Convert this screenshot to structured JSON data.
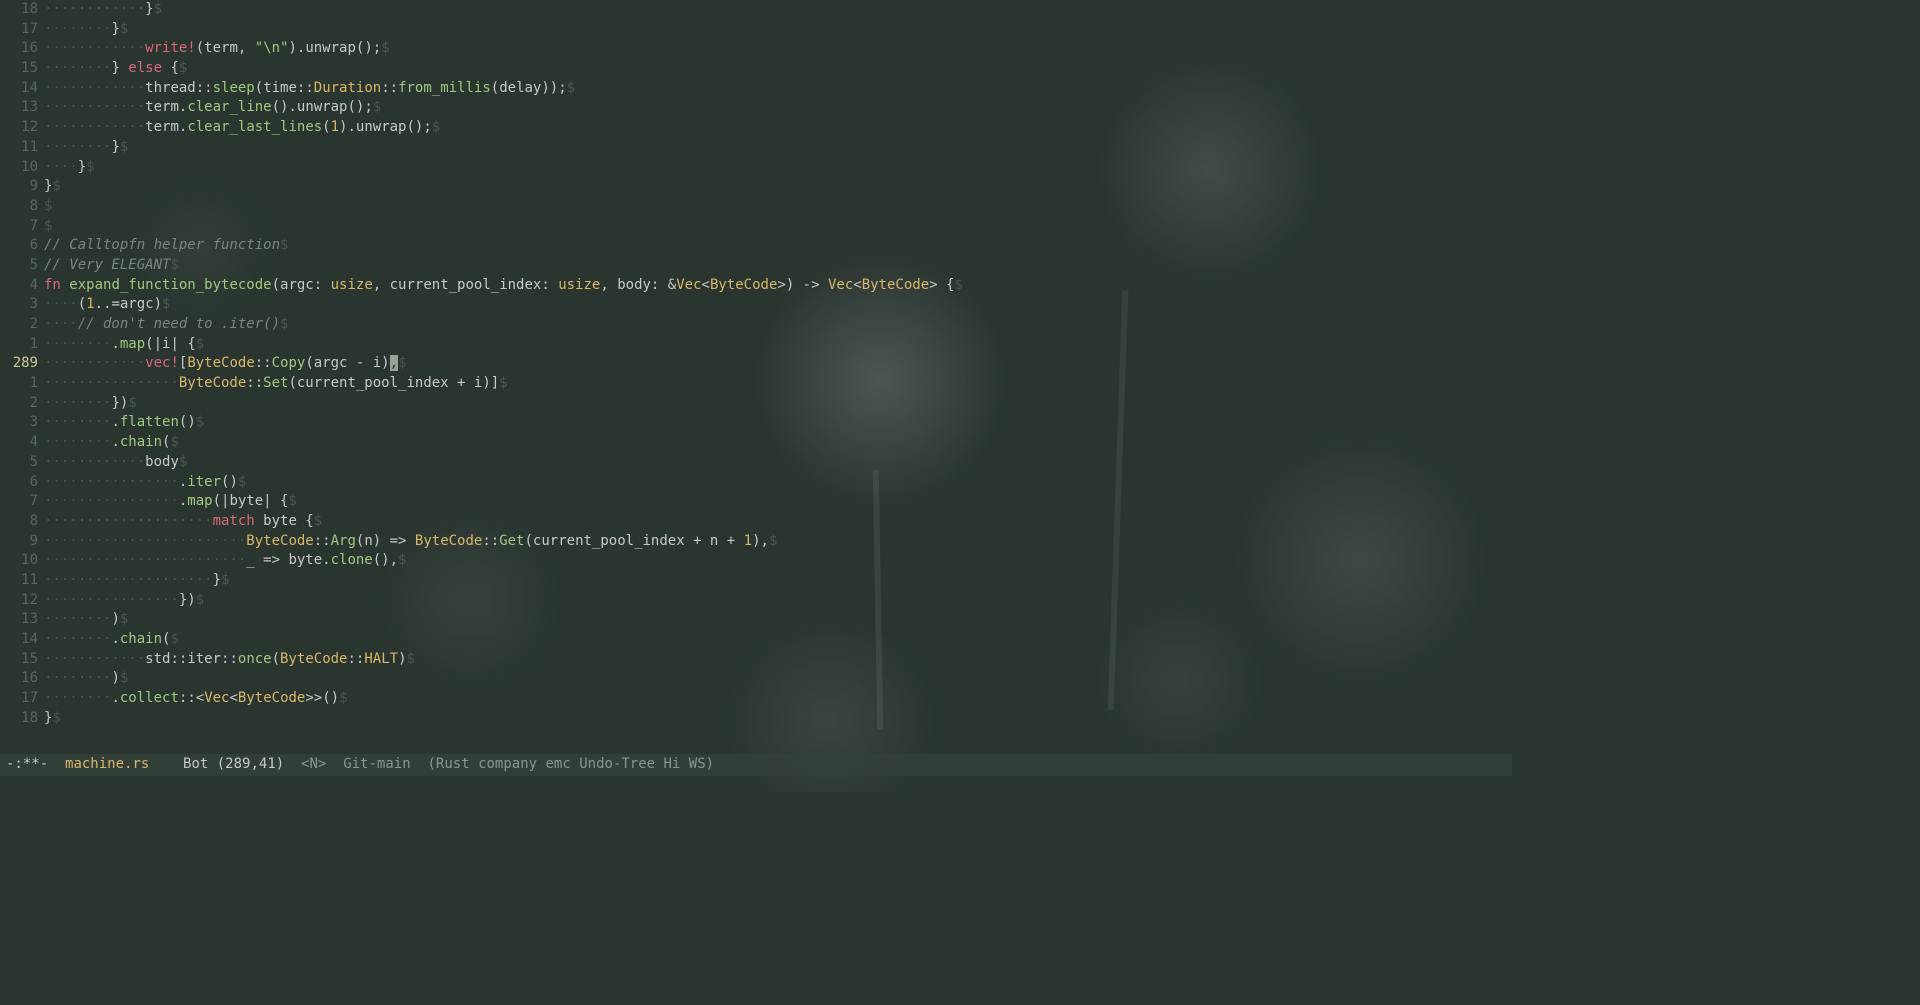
{
  "modeline": {
    "modified": "-:**-",
    "filename": "machine.rs",
    "position": "Bot (289,41)",
    "mode": "<N>",
    "vcs": "Git-main",
    "minor": "(Rust company emc Undo-Tree Hi WS)"
  },
  "cursor": {
    "line_abs": 289,
    "col": 41
  },
  "lines": [
    {
      "rel": "18",
      "tokens": [
        {
          "t": "ws",
          "v": "············"
        },
        {
          "t": "op",
          "v": "}"
        },
        {
          "t": "eol",
          "v": "$"
        }
      ]
    },
    {
      "rel": "17",
      "tokens": [
        {
          "t": "ws",
          "v": "········"
        },
        {
          "t": "op",
          "v": "}"
        },
        {
          "t": "eol",
          "v": "$"
        }
      ]
    },
    {
      "rel": "16",
      "tokens": [
        {
          "t": "ws",
          "v": "············"
        },
        {
          "t": "macro",
          "v": "write!"
        },
        {
          "t": "op",
          "v": "(term, "
        },
        {
          "t": "str",
          "v": "\"\\n\""
        },
        {
          "t": "op",
          "v": ").unwrap();"
        },
        {
          "t": "eol",
          "v": "$"
        }
      ]
    },
    {
      "rel": "15",
      "tokens": [
        {
          "t": "ws",
          "v": "········"
        },
        {
          "t": "op",
          "v": "} "
        },
        {
          "t": "kw",
          "v": "else"
        },
        {
          "t": "op",
          "v": " {"
        },
        {
          "t": "eol",
          "v": "$"
        }
      ]
    },
    {
      "rel": "14",
      "tokens": [
        {
          "t": "ws",
          "v": "············"
        },
        {
          "t": "ident",
          "v": "thread"
        },
        {
          "t": "op",
          "v": "::"
        },
        {
          "t": "fn",
          "v": "sleep"
        },
        {
          "t": "op",
          "v": "("
        },
        {
          "t": "ident",
          "v": "time"
        },
        {
          "t": "op",
          "v": "::"
        },
        {
          "t": "ty",
          "v": "Duration"
        },
        {
          "t": "op",
          "v": "::"
        },
        {
          "t": "fn",
          "v": "from_millis"
        },
        {
          "t": "op",
          "v": "(delay));"
        },
        {
          "t": "eol",
          "v": "$"
        }
      ]
    },
    {
      "rel": "13",
      "tokens": [
        {
          "t": "ws",
          "v": "············"
        },
        {
          "t": "ident",
          "v": "term."
        },
        {
          "t": "fn",
          "v": "clear_line"
        },
        {
          "t": "op",
          "v": "().unwrap();"
        },
        {
          "t": "eol",
          "v": "$"
        }
      ]
    },
    {
      "rel": "12",
      "tokens": [
        {
          "t": "ws",
          "v": "············"
        },
        {
          "t": "ident",
          "v": "term."
        },
        {
          "t": "fn",
          "v": "clear_last_lines"
        },
        {
          "t": "op",
          "v": "("
        },
        {
          "t": "num",
          "v": "1"
        },
        {
          "t": "op",
          "v": ").unwrap();"
        },
        {
          "t": "eol",
          "v": "$"
        }
      ]
    },
    {
      "rel": "11",
      "tokens": [
        {
          "t": "ws",
          "v": "········"
        },
        {
          "t": "op",
          "v": "}"
        },
        {
          "t": "eol",
          "v": "$"
        }
      ]
    },
    {
      "rel": "10",
      "tokens": [
        {
          "t": "ws",
          "v": "····"
        },
        {
          "t": "op",
          "v": "}"
        },
        {
          "t": "eol",
          "v": "$"
        }
      ]
    },
    {
      "rel": "9",
      "tokens": [
        {
          "t": "op",
          "v": "}"
        },
        {
          "t": "eol",
          "v": "$"
        }
      ]
    },
    {
      "rel": "8",
      "tokens": [
        {
          "t": "eol",
          "v": "$"
        }
      ]
    },
    {
      "rel": "7",
      "tokens": [
        {
          "t": "eol",
          "v": "$"
        }
      ]
    },
    {
      "rel": "6",
      "tokens": [
        {
          "t": "cmt",
          "v": "// Calltopfn helper function"
        },
        {
          "t": "eol",
          "v": "$"
        }
      ]
    },
    {
      "rel": "5",
      "tokens": [
        {
          "t": "cmt",
          "v": "// Very ELEGANT"
        },
        {
          "t": "eol",
          "v": "$"
        }
      ]
    },
    {
      "rel": "4",
      "tokens": [
        {
          "t": "kw",
          "v": "fn"
        },
        {
          "t": "op",
          "v": " "
        },
        {
          "t": "fn",
          "v": "expand_function_bytecode"
        },
        {
          "t": "op",
          "v": "(argc: "
        },
        {
          "t": "ty",
          "v": "usize"
        },
        {
          "t": "op",
          "v": ", current_pool_index: "
        },
        {
          "t": "ty",
          "v": "usize"
        },
        {
          "t": "op",
          "v": ", body: &"
        },
        {
          "t": "ty",
          "v": "Vec"
        },
        {
          "t": "op",
          "v": "<"
        },
        {
          "t": "ty",
          "v": "ByteCode"
        },
        {
          "t": "op",
          "v": ">) -> "
        },
        {
          "t": "ty",
          "v": "Vec"
        },
        {
          "t": "op",
          "v": "<"
        },
        {
          "t": "ty",
          "v": "ByteCode"
        },
        {
          "t": "op",
          "v": "> {"
        },
        {
          "t": "eol",
          "v": "$"
        }
      ]
    },
    {
      "rel": "3",
      "tokens": [
        {
          "t": "ws",
          "v": "····"
        },
        {
          "t": "op",
          "v": "("
        },
        {
          "t": "num",
          "v": "1"
        },
        {
          "t": "op",
          "v": "..=argc)"
        },
        {
          "t": "eol",
          "v": "$"
        }
      ]
    },
    {
      "rel": "2",
      "tokens": [
        {
          "t": "ws",
          "v": "····"
        },
        {
          "t": "cmt",
          "v": "// don't need to .iter()"
        },
        {
          "t": "eol",
          "v": "$"
        }
      ]
    },
    {
      "rel": "1",
      "tokens": [
        {
          "t": "ws",
          "v": "········"
        },
        {
          "t": "op",
          "v": "."
        },
        {
          "t": "fn",
          "v": "map"
        },
        {
          "t": "op",
          "v": "(|i| {"
        },
        {
          "t": "eol",
          "v": "$"
        }
      ]
    },
    {
      "rel": "289",
      "current": true,
      "tokens": [
        {
          "t": "ws",
          "v": "············"
        },
        {
          "t": "macro",
          "v": "vec!"
        },
        {
          "t": "op",
          "v": "["
        },
        {
          "t": "ty",
          "v": "ByteCode"
        },
        {
          "t": "op",
          "v": "::"
        },
        {
          "t": "fn",
          "v": "Copy"
        },
        {
          "t": "op",
          "v": "(argc - i)"
        },
        {
          "t": "cursor",
          "v": ","
        },
        {
          "t": "eol",
          "v": "$"
        }
      ]
    },
    {
      "rel": "1",
      "tokens": [
        {
          "t": "ws",
          "v": "················"
        },
        {
          "t": "ty",
          "v": "ByteCode"
        },
        {
          "t": "op",
          "v": "::"
        },
        {
          "t": "fn",
          "v": "Set"
        },
        {
          "t": "op",
          "v": "(current_pool_index + i)]"
        },
        {
          "t": "eol",
          "v": "$"
        }
      ]
    },
    {
      "rel": "2",
      "tokens": [
        {
          "t": "ws",
          "v": "········"
        },
        {
          "t": "op",
          "v": "})"
        },
        {
          "t": "eol",
          "v": "$"
        }
      ]
    },
    {
      "rel": "3",
      "tokens": [
        {
          "t": "ws",
          "v": "········"
        },
        {
          "t": "op",
          "v": "."
        },
        {
          "t": "fn",
          "v": "flatten"
        },
        {
          "t": "op",
          "v": "()"
        },
        {
          "t": "eol",
          "v": "$"
        }
      ]
    },
    {
      "rel": "4",
      "tokens": [
        {
          "t": "ws",
          "v": "········"
        },
        {
          "t": "op",
          "v": "."
        },
        {
          "t": "fn",
          "v": "chain"
        },
        {
          "t": "op",
          "v": "("
        },
        {
          "t": "eol",
          "v": "$"
        }
      ]
    },
    {
      "rel": "5",
      "tokens": [
        {
          "t": "ws",
          "v": "············"
        },
        {
          "t": "ident",
          "v": "body"
        },
        {
          "t": "eol",
          "v": "$"
        }
      ]
    },
    {
      "rel": "6",
      "tokens": [
        {
          "t": "ws",
          "v": "················"
        },
        {
          "t": "op",
          "v": "."
        },
        {
          "t": "fn",
          "v": "iter"
        },
        {
          "t": "op",
          "v": "()"
        },
        {
          "t": "eol",
          "v": "$"
        }
      ]
    },
    {
      "rel": "7",
      "tokens": [
        {
          "t": "ws",
          "v": "················"
        },
        {
          "t": "op",
          "v": "."
        },
        {
          "t": "fn",
          "v": "map"
        },
        {
          "t": "op",
          "v": "(|byte| {"
        },
        {
          "t": "eol",
          "v": "$"
        }
      ]
    },
    {
      "rel": "8",
      "tokens": [
        {
          "t": "ws",
          "v": "····················"
        },
        {
          "t": "kw",
          "v": "match"
        },
        {
          "t": "op",
          "v": " byte {"
        },
        {
          "t": "eol",
          "v": "$"
        }
      ]
    },
    {
      "rel": "9",
      "tokens": [
        {
          "t": "ws",
          "v": "························"
        },
        {
          "t": "ty",
          "v": "ByteCode"
        },
        {
          "t": "op",
          "v": "::"
        },
        {
          "t": "fn",
          "v": "Arg"
        },
        {
          "t": "op",
          "v": "(n) => "
        },
        {
          "t": "ty",
          "v": "ByteCode"
        },
        {
          "t": "op",
          "v": "::"
        },
        {
          "t": "fn",
          "v": "Get"
        },
        {
          "t": "op",
          "v": "(current_pool_index + n + "
        },
        {
          "t": "num",
          "v": "1"
        },
        {
          "t": "op",
          "v": "),"
        },
        {
          "t": "eol",
          "v": "$"
        }
      ]
    },
    {
      "rel": "10",
      "tokens": [
        {
          "t": "ws",
          "v": "························"
        },
        {
          "t": "op",
          "v": "_ => byte."
        },
        {
          "t": "fn",
          "v": "clone"
        },
        {
          "t": "op",
          "v": "(),"
        },
        {
          "t": "eol",
          "v": "$"
        }
      ]
    },
    {
      "rel": "11",
      "tokens": [
        {
          "t": "ws",
          "v": "····················"
        },
        {
          "t": "op",
          "v": "}"
        },
        {
          "t": "eol",
          "v": "$"
        }
      ]
    },
    {
      "rel": "12",
      "tokens": [
        {
          "t": "ws",
          "v": "················"
        },
        {
          "t": "op",
          "v": "})"
        },
        {
          "t": "eol",
          "v": "$"
        }
      ]
    },
    {
      "rel": "13",
      "tokens": [
        {
          "t": "ws",
          "v": "········"
        },
        {
          "t": "op",
          "v": ")"
        },
        {
          "t": "eol",
          "v": "$"
        }
      ]
    },
    {
      "rel": "14",
      "tokens": [
        {
          "t": "ws",
          "v": "········"
        },
        {
          "t": "op",
          "v": "."
        },
        {
          "t": "fn",
          "v": "chain"
        },
        {
          "t": "op",
          "v": "("
        },
        {
          "t": "eol",
          "v": "$"
        }
      ]
    },
    {
      "rel": "15",
      "tokens": [
        {
          "t": "ws",
          "v": "············"
        },
        {
          "t": "ident",
          "v": "std"
        },
        {
          "t": "op",
          "v": "::"
        },
        {
          "t": "ident",
          "v": "iter"
        },
        {
          "t": "op",
          "v": "::"
        },
        {
          "t": "fn",
          "v": "once"
        },
        {
          "t": "op",
          "v": "("
        },
        {
          "t": "ty",
          "v": "ByteCode"
        },
        {
          "t": "op",
          "v": "::"
        },
        {
          "t": "ty",
          "v": "HALT"
        },
        {
          "t": "op",
          "v": ")"
        },
        {
          "t": "eol",
          "v": "$"
        }
      ]
    },
    {
      "rel": "16",
      "tokens": [
        {
          "t": "ws",
          "v": "········"
        },
        {
          "t": "op",
          "v": ")"
        },
        {
          "t": "eol",
          "v": "$"
        }
      ]
    },
    {
      "rel": "17",
      "tokens": [
        {
          "t": "ws",
          "v": "········"
        },
        {
          "t": "op",
          "v": "."
        },
        {
          "t": "fn",
          "v": "collect"
        },
        {
          "t": "op",
          "v": "::<"
        },
        {
          "t": "ty",
          "v": "Vec"
        },
        {
          "t": "op",
          "v": "<"
        },
        {
          "t": "ty",
          "v": "ByteCode"
        },
        {
          "t": "op",
          "v": ">>()"
        },
        {
          "t": "eol",
          "v": "$"
        }
      ]
    },
    {
      "rel": "18",
      "tokens": [
        {
          "t": "op",
          "v": "}"
        },
        {
          "t": "eol",
          "v": "$"
        }
      ]
    }
  ]
}
